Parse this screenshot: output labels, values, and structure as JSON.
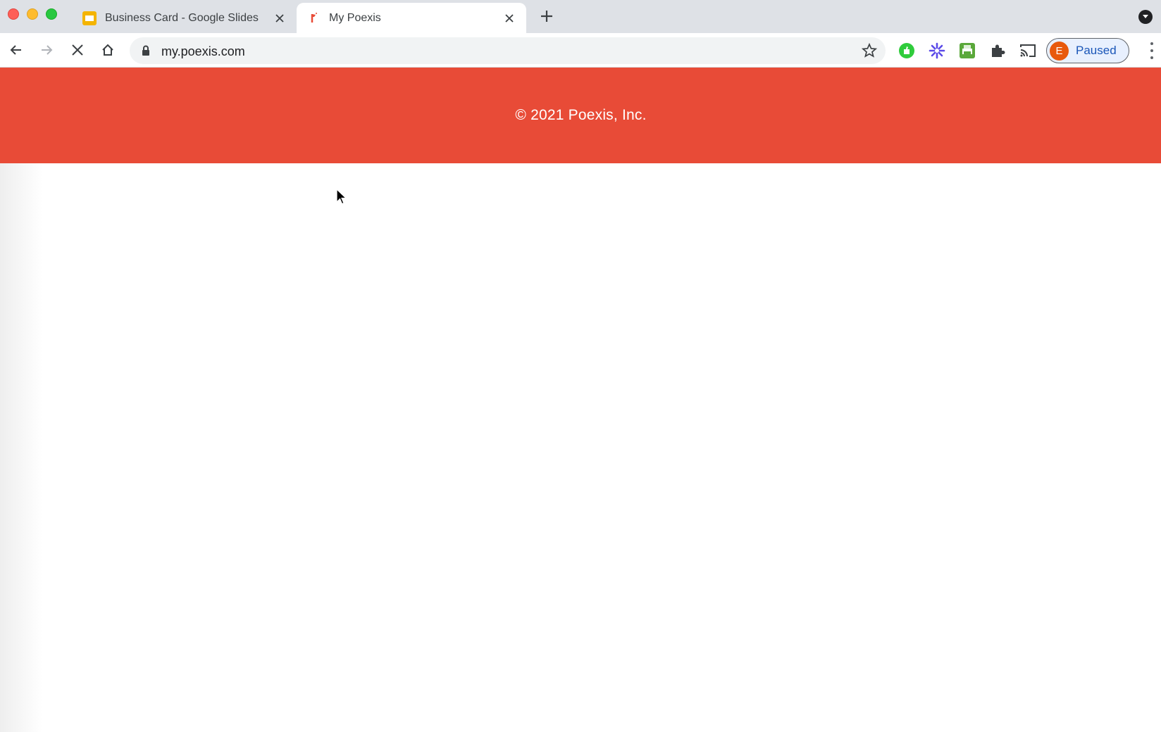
{
  "browser": {
    "tabs": [
      {
        "title": "Business Card - Google Slides",
        "favicon": "google-slides-icon",
        "active": false
      },
      {
        "title": "My Poexis",
        "favicon": "poexis-icon",
        "active": true
      }
    ],
    "address": {
      "url": "my.poexis.com"
    },
    "profile": {
      "initial": "E",
      "status": "Paused"
    },
    "extensions": [
      "green-extension-icon",
      "purple-asterisk-extension-icon",
      "printer-extension-icon",
      "puzzle-extensions-icon",
      "cast-icon"
    ]
  },
  "page": {
    "footer": {
      "copyright": "© 2021 Poexis, Inc.",
      "background": "#e84b37"
    }
  }
}
